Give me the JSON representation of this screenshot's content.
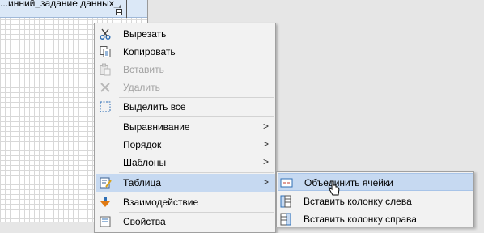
{
  "canvas": {
    "band_text": "...инний_задание данных_д"
  },
  "context_menu": {
    "items": [
      {
        "label": "Вырезать",
        "icon": "scissors-icon",
        "disabled": false
      },
      {
        "label": "Копировать",
        "icon": "copy-icon",
        "disabled": false
      },
      {
        "label": "Вставить",
        "icon": "paste-icon",
        "disabled": true
      },
      {
        "label": "Удалить",
        "icon": "delete-icon",
        "disabled": true
      },
      {
        "label": "Выделить все",
        "icon": "select-all-icon",
        "disabled": false
      },
      {
        "label": "Выравнивание",
        "submenu": true
      },
      {
        "label": "Порядок",
        "submenu": true
      },
      {
        "label": "Шаблоны",
        "submenu": true
      },
      {
        "label": "Таблица",
        "icon": "table-edit-icon",
        "submenu": true,
        "highlighted": true
      },
      {
        "label": "Взаимодействие",
        "icon": "interaction-icon"
      },
      {
        "label": "Свойства",
        "icon": "properties-icon"
      }
    ],
    "arrow": ">"
  },
  "table_submenu": {
    "items": [
      {
        "label": "Объединить ячейки",
        "icon": "merge-cells-icon",
        "highlighted": true
      },
      {
        "label": "Вставить колонку слева",
        "icon": "insert-column-left-icon"
      },
      {
        "label": "Вставить колонку справа",
        "icon": "insert-column-right-icon"
      }
    ]
  },
  "colors": {
    "highlight": "#c6d9f1",
    "menu_bg": "#f2f2f2",
    "disabled_text": "#a2a2a2"
  }
}
